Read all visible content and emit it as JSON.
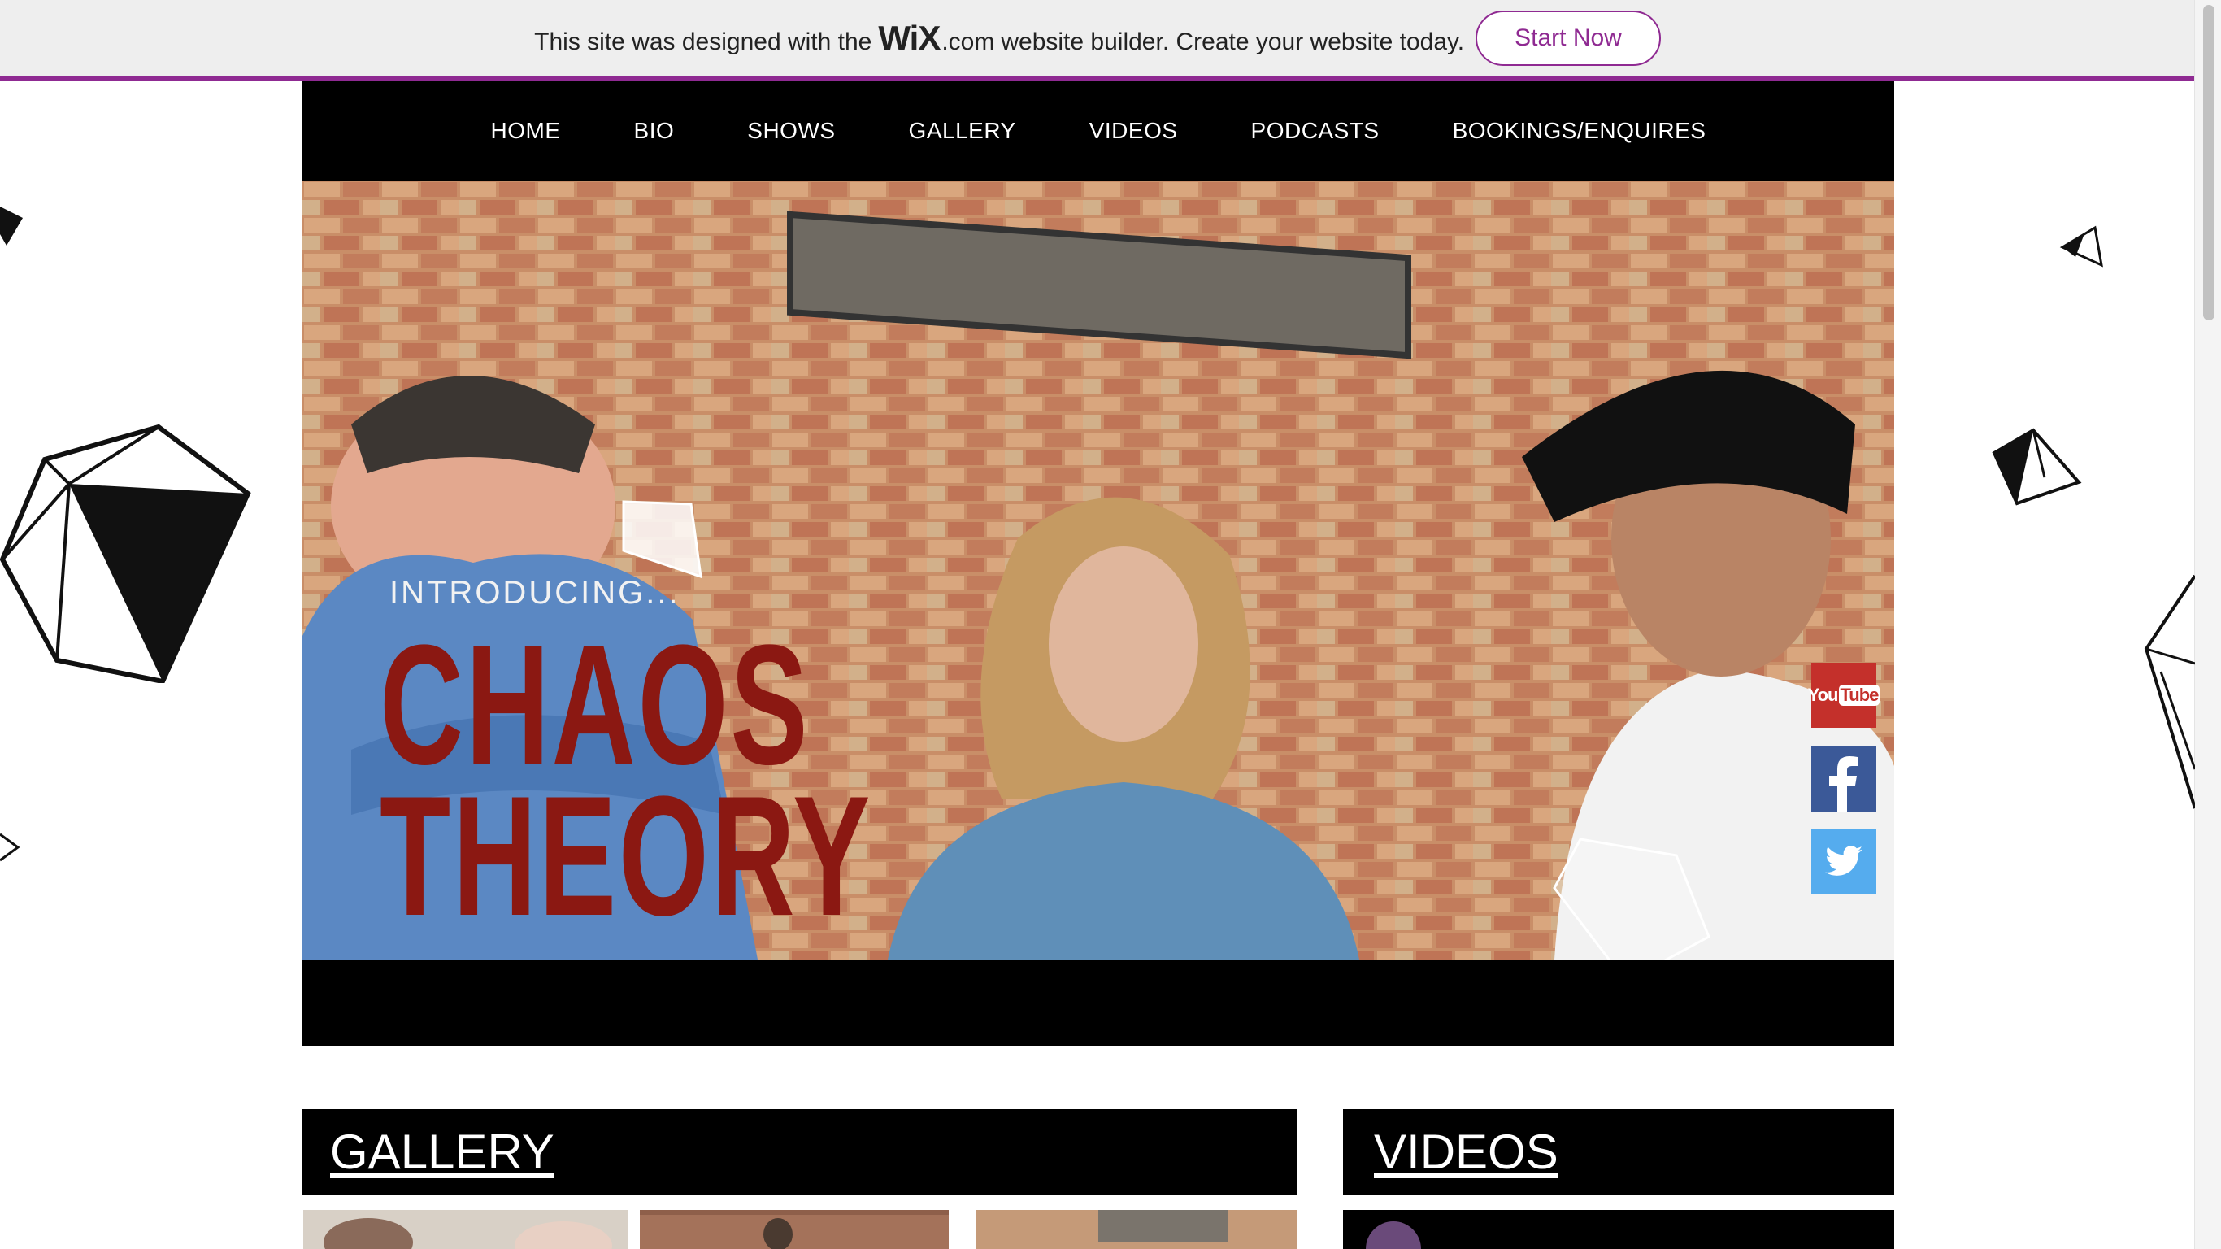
{
  "wix_banner": {
    "text_before": "This site was designed with the",
    "brand": "WiX",
    "brand_suffix": ".com",
    "text_after": "website builder. Create your website today.",
    "button_label": "Start Now"
  },
  "nav": {
    "items": [
      {
        "label": "HOME"
      },
      {
        "label": "BIO"
      },
      {
        "label": "SHOWS"
      },
      {
        "label": "GALLERY"
      },
      {
        "label": "VIDEOS"
      },
      {
        "label": "PODCASTS"
      },
      {
        "label": "BOOKINGS/ENQUIRES"
      }
    ]
  },
  "hero": {
    "intro": "INTRODUCING...",
    "title_line1": "CHAOS",
    "title_line2": "THEORY"
  },
  "social": {
    "youtube": {
      "label_you": "You",
      "label_tube": "Tube",
      "icon": "youtube-icon"
    },
    "facebook": {
      "icon": "facebook-icon"
    },
    "twitter": {
      "icon": "twitter-icon"
    }
  },
  "sections": {
    "gallery_title": "GALLERY",
    "videos_title": "VIDEOS"
  },
  "colors": {
    "wix_purple": "#8f2a92",
    "title_red": "#8b1812",
    "youtube": "#c4302b",
    "facebook": "#3b5998",
    "twitter": "#55acee"
  }
}
